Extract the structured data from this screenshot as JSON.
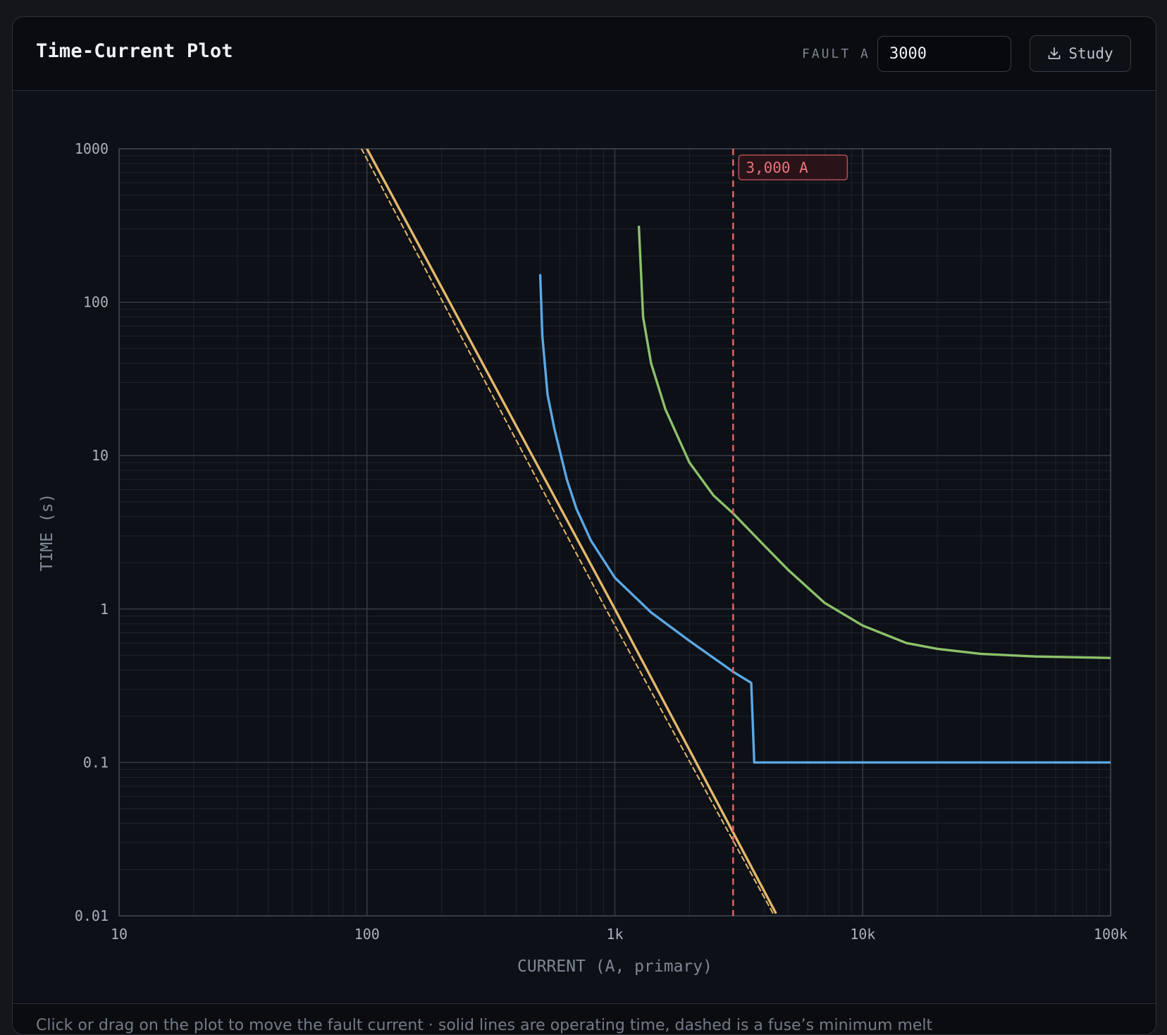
{
  "header": {
    "title": "Time-Current Plot",
    "fault_label": "FAULT A",
    "fault_value": "3000",
    "study_label": "Study"
  },
  "footer": {
    "hint": "Click or drag on the plot to move the fault current · solid lines are operating time, dashed is a fuse’s minimum melt"
  },
  "colors": {
    "fuse": "#e5b86b",
    "relay": "#5aa9e6",
    "upstream": "#8dc16a",
    "fault": "#e0636a",
    "grid_major": "#353b47",
    "grid_minor": "#1f242d",
    "background": "#0d1016"
  },
  "chart_data": {
    "type": "line",
    "title": "Time-Current Plot",
    "xlabel": "CURRENT (A, primary)",
    "ylabel": "TIME (s)",
    "x_scale": "log",
    "y_scale": "log",
    "xlim": [
      10,
      100000
    ],
    "ylim": [
      0.01,
      1000
    ],
    "grid": true,
    "x_ticks": [
      {
        "value": 10,
        "label": "10"
      },
      {
        "value": 100,
        "label": "100"
      },
      {
        "value": 1000,
        "label": "1k"
      },
      {
        "value": 10000,
        "label": "10k"
      },
      {
        "value": 100000,
        "label": "100k"
      }
    ],
    "y_ticks": [
      {
        "value": 0.01,
        "label": "0.01"
      },
      {
        "value": 0.1,
        "label": "0.1"
      },
      {
        "value": 1,
        "label": "1"
      },
      {
        "value": 10,
        "label": "10"
      },
      {
        "value": 100,
        "label": "100"
      },
      {
        "value": 1000,
        "label": "1000"
      }
    ],
    "fault_marker": {
      "x": 3000,
      "label": "3,000 A"
    },
    "series": [
      {
        "key": "fuse-min-melt",
        "style": "dashed",
        "color": "#e5b86b",
        "points": [
          [
            95,
            1000
          ],
          [
            920,
            1.0
          ],
          [
            4400,
            0.01
          ]
        ]
      },
      {
        "key": "fuse-total-clear",
        "style": "solid",
        "color": "#e5b86b",
        "points": [
          [
            100,
            1000
          ],
          [
            1000,
            1.0
          ],
          [
            4450,
            0.0105
          ]
        ]
      },
      {
        "key": "relay",
        "style": "solid",
        "color": "#5aa9e6",
        "points": [
          [
            500,
            150
          ],
          [
            510,
            60
          ],
          [
            535,
            25
          ],
          [
            570,
            15
          ],
          [
            640,
            7
          ],
          [
            700,
            4.5
          ],
          [
            800,
            2.8
          ],
          [
            1000,
            1.6
          ],
          [
            1400,
            0.95
          ],
          [
            2000,
            0.62
          ],
          [
            2700,
            0.44
          ],
          [
            3000,
            0.39
          ],
          [
            3550,
            0.33
          ],
          [
            3650,
            0.1
          ],
          [
            100000,
            0.1
          ]
        ]
      },
      {
        "key": "upstream-relay",
        "style": "solid",
        "color": "#8dc16a",
        "points": [
          [
            1250,
            310
          ],
          [
            1300,
            80
          ],
          [
            1400,
            40
          ],
          [
            1600,
            20
          ],
          [
            2000,
            9
          ],
          [
            2500,
            5.5
          ],
          [
            3000,
            4.2
          ],
          [
            4000,
            2.6
          ],
          [
            5000,
            1.8
          ],
          [
            7000,
            1.1
          ],
          [
            10000,
            0.78
          ],
          [
            15000,
            0.6
          ],
          [
            20000,
            0.55
          ],
          [
            30000,
            0.51
          ],
          [
            50000,
            0.49
          ],
          [
            100000,
            0.48
          ]
        ]
      }
    ]
  }
}
